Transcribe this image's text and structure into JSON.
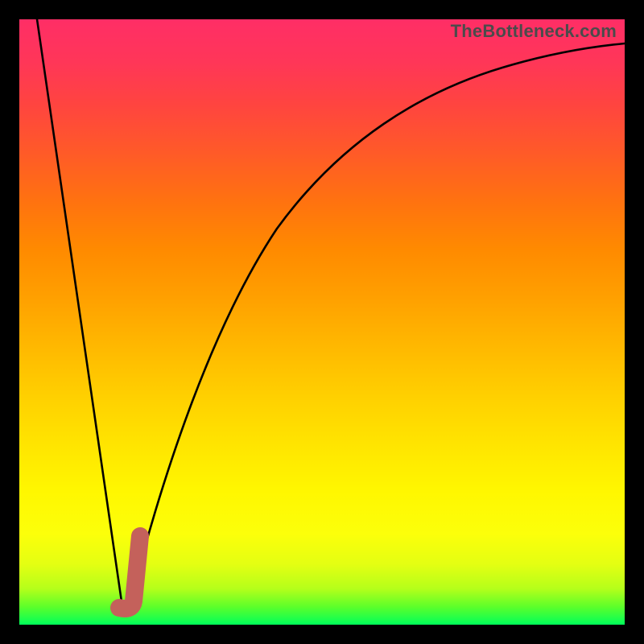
{
  "watermark": "TheBottleneck.com",
  "colors": {
    "frame": "#000000",
    "curve": "#000000",
    "marker": "#c4615b",
    "gradient_top": "#ff2e66",
    "gradient_bottom": "#00ff5a"
  },
  "chart_data": {
    "type": "line",
    "title": "",
    "xlabel": "",
    "ylabel": "",
    "xlim": [
      0,
      100
    ],
    "ylim": [
      0,
      100
    ],
    "grid": false,
    "legend": false,
    "series": [
      {
        "name": "bottleneck-curve",
        "x": [
          2,
          6,
          10,
          14,
          16,
          18,
          20,
          22,
          26,
          30,
          35,
          40,
          45,
          50,
          55,
          60,
          65,
          70,
          75,
          80,
          85,
          90,
          95,
          100
        ],
        "y": [
          100,
          78,
          55,
          30,
          15,
          3,
          10,
          25,
          48,
          60,
          70,
          76,
          80,
          83,
          85.5,
          87.5,
          89,
          90.2,
          91.2,
          92,
          92.7,
          93.3,
          93.8,
          94
        ]
      }
    ],
    "annotations": [
      {
        "name": "marker-hook",
        "shape": "j-hook",
        "approx_x_range": [
          16,
          20
        ],
        "approx_y_range": [
          0,
          14
        ],
        "color": "#c4615b"
      }
    ]
  }
}
